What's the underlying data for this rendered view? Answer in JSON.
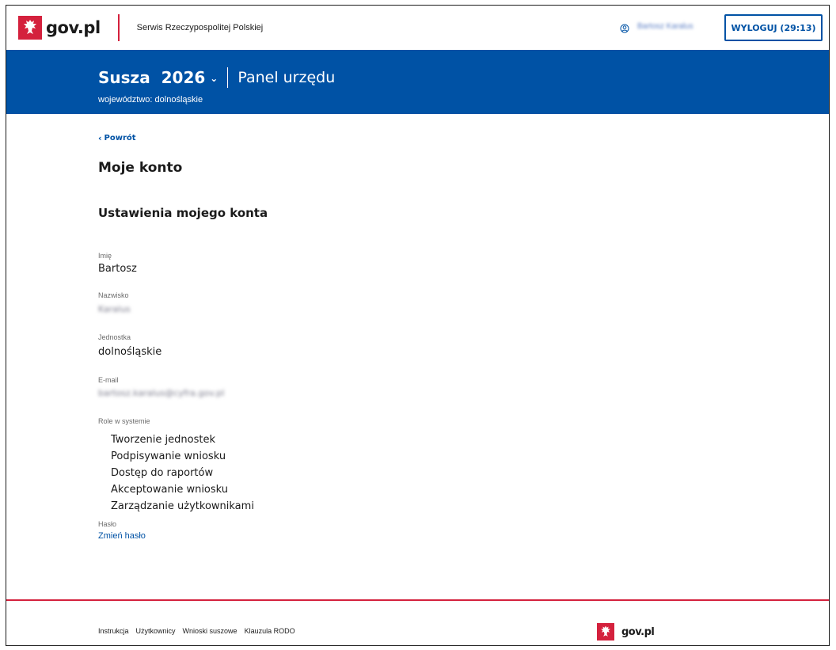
{
  "header": {
    "logo_text": "gov.pl",
    "service_name": "Serwis Rzeczypospolitej Polskiej",
    "user_name": "Bartosz Karalus",
    "logout_label": "WYLOGUJ (29:13)"
  },
  "banner": {
    "program": "Susza  2026",
    "panel_title": "Panel urzędu",
    "region": "województwo: dolnośląskie"
  },
  "page": {
    "back_label": "Powrót",
    "title": "Moje konto",
    "section_title": "Ustawienia mojego konta"
  },
  "fields": {
    "first_name_label": "Imię",
    "first_name_value": "Bartosz",
    "last_name_label": "Nazwisko",
    "last_name_value": "Karalus",
    "unit_label": "Jednostka",
    "unit_value": "dolnośląskie",
    "email_label": "E-mail",
    "email_value": "bartosz.karalus@cyfra.gov.pl",
    "roles_label": "Role w systemie",
    "roles": [
      "Tworzenie jednostek",
      "Podpisywanie wniosku",
      "Dostęp do raportów",
      "Akceptowanie wniosku",
      "Zarządzanie użytkownikami"
    ],
    "password_label": "Hasło",
    "change_password_label": "Zmień hasło"
  },
  "footer": {
    "links": [
      "Instrukcja",
      "Użytkownicy",
      "Wnioski suszowe",
      "Klauzula RODO"
    ],
    "logo_text": "gov.pl"
  },
  "colors": {
    "primary": "#0052a5",
    "accent_red": "#d4213d"
  }
}
